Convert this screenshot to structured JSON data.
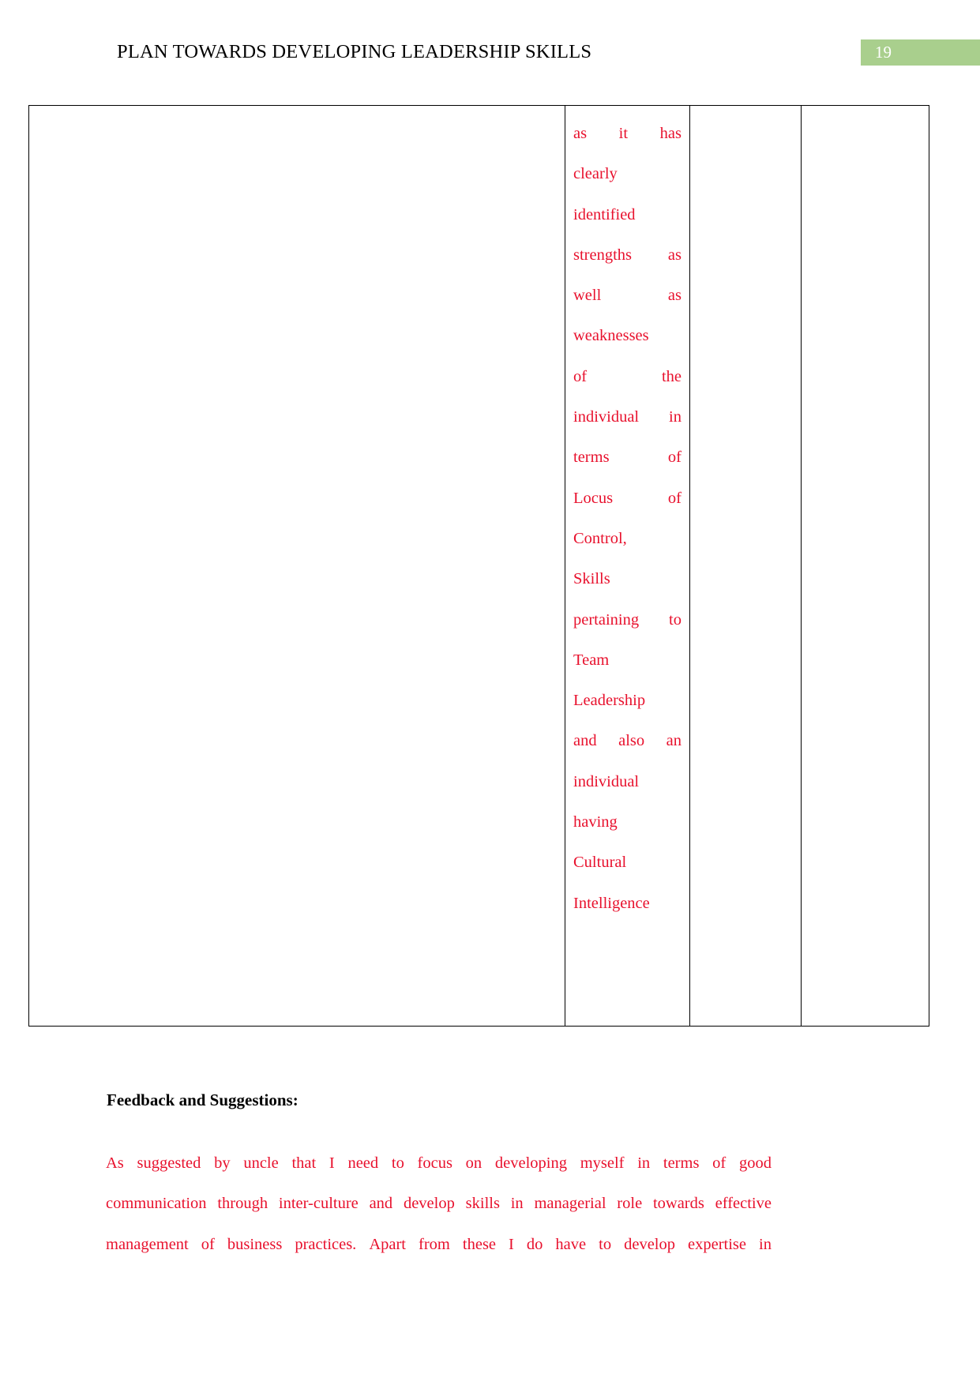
{
  "header": {
    "title": "PLAN TOWARDS DEVELOPING LEADERSHIP SKILLS",
    "page_number": "19",
    "badge_color": "#a9cf8d"
  },
  "colors": {
    "red_text": "#e8112d",
    "black_text": "#000000",
    "table_border": "#000000"
  },
  "table": {
    "columns": [
      "",
      "",
      "",
      ""
    ],
    "cell_red_lines": [
      [
        "as",
        "it",
        "has"
      ],
      [
        "clearly"
      ],
      [
        "identified"
      ],
      [
        "strengths",
        "as"
      ],
      [
        "well",
        "as"
      ],
      [
        "weaknesses"
      ],
      [
        "of",
        "the"
      ],
      [
        "individual",
        "in"
      ],
      [
        "terms",
        "of"
      ],
      [
        "Locus",
        "of"
      ],
      [
        "Control,"
      ],
      [
        "Skills"
      ],
      [
        "pertaining",
        "to"
      ],
      [
        "Team"
      ],
      [
        "Leadership"
      ],
      [
        "and",
        "also",
        "an"
      ],
      [
        "individual"
      ],
      [
        "having"
      ],
      [
        "Cultural"
      ],
      [
        "Intelligence"
      ]
    ],
    "cell_red_text": "as it has clearly identified strengths as well as weaknesses of the individual in terms of Locus of Control, Skills pertaining to Team Leadership and also an individual having Cultural Intelligence"
  },
  "feedback": {
    "heading": "Feedback and Suggestions:",
    "paragraph_lines": [
      [
        "As",
        "suggested",
        "by",
        " uncle",
        "that",
        "I",
        "need",
        "to",
        "focus",
        "on",
        "developing",
        "myself",
        "in",
        "terms",
        "of",
        "good"
      ],
      [
        "communication",
        "through",
        "inter-culture",
        "and",
        "develop",
        "skills",
        "in",
        "managerial",
        "role",
        "towards",
        "effective"
      ],
      [
        "management",
        "of",
        "business",
        "practices.",
        "Apart",
        "from",
        "these",
        "I",
        "do",
        "have",
        "to",
        "develop",
        "expertise",
        "in"
      ]
    ],
    "paragraph_text": "As suggested by  uncle that I need to focus on developing myself in terms of good communication through inter-culture and develop skills in managerial role towards effective management of business practices. Apart from these I do have to develop expertise in"
  }
}
